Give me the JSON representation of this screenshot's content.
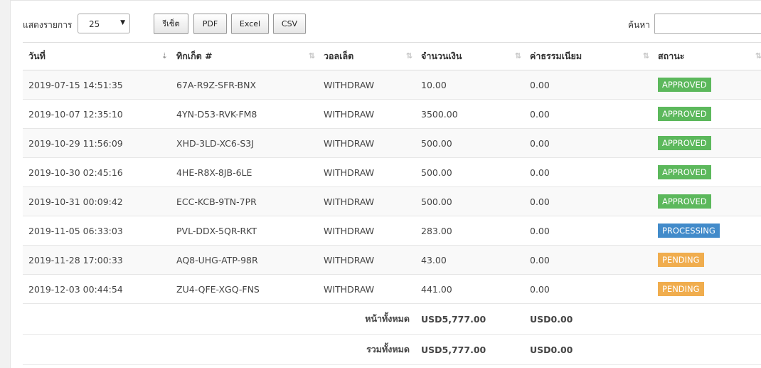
{
  "toolbar": {
    "length_label": "แสดงรายการ",
    "length_value": "25",
    "buttons": [
      "รีเซ็ต",
      "PDF",
      "Excel",
      "CSV"
    ],
    "search_label": "ค้นหา",
    "search_value": ""
  },
  "table": {
    "headers": [
      "วันที่",
      "ทิกเก็ต #",
      "วอลเล็ต",
      "จำนวนเงิน",
      "ค่าธรรมเนียม",
      "สถานะ"
    ],
    "rows": [
      {
        "date": "2019-07-15 14:51:35",
        "ticket": "67A-R9Z-SFR-BNX",
        "wallet": "WITHDRAW",
        "amount": "10.00",
        "fee": "0.00",
        "status": "APPROVED"
      },
      {
        "date": "2019-10-07 12:35:10",
        "ticket": "4YN-D53-RVK-FM8",
        "wallet": "WITHDRAW",
        "amount": "3500.00",
        "fee": "0.00",
        "status": "APPROVED"
      },
      {
        "date": "2019-10-29 11:56:09",
        "ticket": "XHD-3LD-XC6-S3J",
        "wallet": "WITHDRAW",
        "amount": "500.00",
        "fee": "0.00",
        "status": "APPROVED"
      },
      {
        "date": "2019-10-30 02:45:16",
        "ticket": "4HE-R8X-8JB-6LE",
        "wallet": "WITHDRAW",
        "amount": "500.00",
        "fee": "0.00",
        "status": "APPROVED"
      },
      {
        "date": "2019-10-31 00:09:42",
        "ticket": "ECC-KCB-9TN-7PR",
        "wallet": "WITHDRAW",
        "amount": "500.00",
        "fee": "0.00",
        "status": "APPROVED"
      },
      {
        "date": "2019-11-05 06:33:03",
        "ticket": "PVL-DDX-5QR-RKT",
        "wallet": "WITHDRAW",
        "amount": "283.00",
        "fee": "0.00",
        "status": "PROCESSING"
      },
      {
        "date": "2019-11-28 17:00:33",
        "ticket": "AQ8-UHG-ATP-98R",
        "wallet": "WITHDRAW",
        "amount": "43.00",
        "fee": "0.00",
        "status": "PENDING"
      },
      {
        "date": "2019-12-03 00:44:54",
        "ticket": "ZU4-QFE-XGQ-FNS",
        "wallet": "WITHDRAW",
        "amount": "441.00",
        "fee": "0.00",
        "status": "PENDING"
      }
    ],
    "status_colors": {
      "APPROVED": "#5cb85c",
      "PROCESSING": "#428bca",
      "PENDING": "#f0ad4e"
    },
    "footer": [
      {
        "label": "หน้าทั้งหมด",
        "amount": "USD5,777.00",
        "fee": "USD0.00"
      },
      {
        "label": "รวมทั้งหมด",
        "amount": "USD5,777.00",
        "fee": "USD0.00"
      }
    ]
  }
}
